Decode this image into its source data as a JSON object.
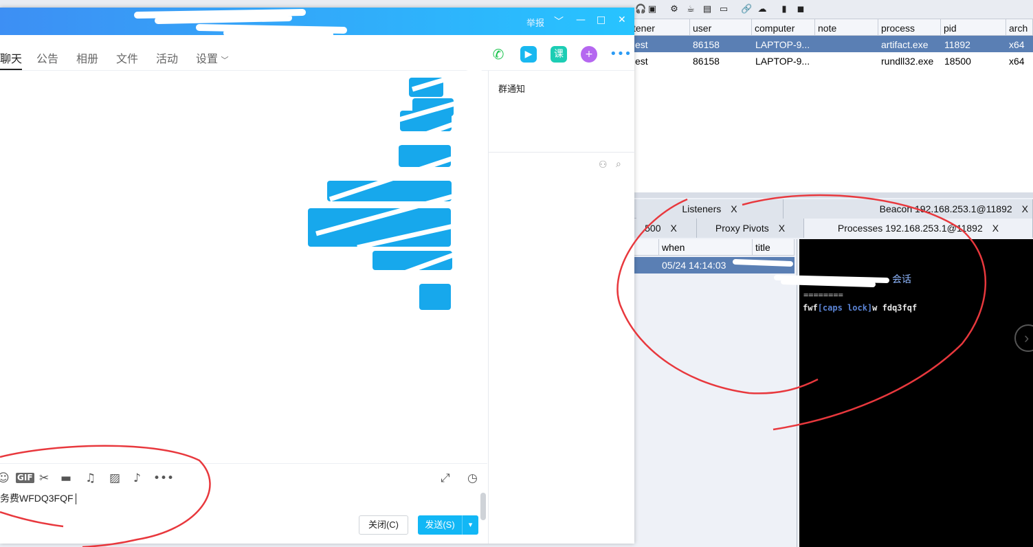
{
  "cobalt": {
    "beacon_table": {
      "columns": [
        "stener",
        "user",
        "computer",
        "note",
        "process",
        "pid",
        "arch"
      ],
      "rows": [
        {
          "listener": "est",
          "user": "86158",
          "computer": "LAPTOP-9...",
          "note": "",
          "process": "artifact.exe",
          "pid": "11892",
          "arch": "x64"
        },
        {
          "listener": "est",
          "user": "86158",
          "computer": "LAPTOP-9...",
          "note": "",
          "process": "rundll32.exe",
          "pid": "18500",
          "arch": "x64"
        }
      ]
    },
    "tabs_row1": [
      {
        "label": "Listeners",
        "close": "X"
      },
      {
        "label": "Beacon 192.168.253.1@11892",
        "close": "X"
      }
    ],
    "tabs_row2": [
      {
        "label": "500",
        "close": "X"
      },
      {
        "label": "Proxy Pivots",
        "close": "X"
      },
      {
        "label": "Processes 192.168.253.1@11892",
        "close": "X"
      }
    ],
    "keystrokes": {
      "columns": [
        "n",
        "when",
        "title"
      ],
      "row_when": "05/24 14:14:03"
    },
    "console": {
      "title": "会话",
      "separator": "========",
      "line_prefix": "fwf",
      "line_caps": "[caps lock]",
      "line_suffix": "w fdq3fqf"
    }
  },
  "qq": {
    "report_label": "举报",
    "tabs": [
      "聊天",
      "公告",
      "相册",
      "文件",
      "活动",
      "设置"
    ],
    "sidebar_notice_title": "群通知",
    "toolbar_course_label": "课",
    "input_toolbar_gif": "GIF",
    "input_text": "务费WFDQ3FQF",
    "close_button": "关闭(C)",
    "send_button": "发送(S)"
  },
  "colors": {
    "qq_title_gradient_start": "#3d8ff4",
    "qq_title_gradient_end": "#27c4ff",
    "selected_row": "#5a7fb4",
    "annotation_red": "#e8383d",
    "send_blue": "#12b7f5"
  }
}
